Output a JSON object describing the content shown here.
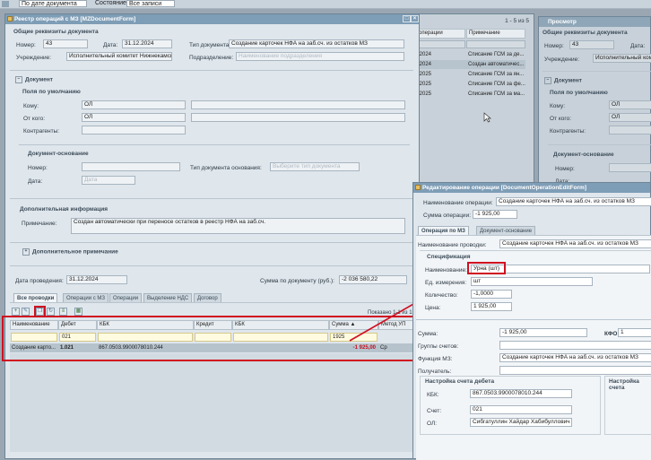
{
  "topbar": {
    "sort_value": "По дате документа",
    "state_label": "Состояние:",
    "state_value": "Все записи"
  },
  "left_window": {
    "title": "Реестр операций с МЗ [MZDocumentForm]",
    "general_section": "Общие реквизиты документа",
    "number_label": "Номер:",
    "number_value": "43",
    "date_label": "Дата:",
    "date_value": "31.12.2024",
    "doctype_label": "Тип документа:",
    "doctype_value": "Создание карточек НФА на заб.сч. из остатков МЗ",
    "institution_label": "Учреждение:",
    "institution_value": "Исполнительный комитет Нижнекамск",
    "division_label": "Подразделение:",
    "division_placeholder": "Наименование подразделения",
    "document_section": "Документ",
    "defaults_section": "Поля по умолчанию",
    "to_label": "Кому:",
    "to_value": "ОЛ",
    "from_label": "От кого:",
    "from_value": "ОЛ",
    "contractors_label": "Контрагенты:",
    "basis_section": "Документ-основание",
    "basis_number_label": "Номер:",
    "basis_type_label": "Тип документа основания:",
    "basis_type_placeholder": "Выберите тип документа",
    "basis_date_label": "Дата:",
    "basis_date_placeholder": "Дата",
    "extra_section": "Дополнительная информация",
    "notes_label": "Примечание:",
    "notes_value": "Создан автоматически при переносе остатков в реестр НФА на заб.сч.",
    "extra_note_section": "Дополнительное примечание",
    "posting_date_label": "Дата проведения:",
    "posting_date_value": "31.12.2024",
    "sum_label": "Сумма по документу (руб.):",
    "sum_value": "-2 036 580,22",
    "tabs": [
      "Все проводки",
      "Операции с МЗ",
      "Операции",
      "Выделение НДС",
      "Договор"
    ],
    "shown_label": "Показано 1-1 из 1",
    "grid_headers": [
      "Наименование",
      "Дебет",
      "КБК",
      "Кредит",
      "КБК",
      "Сумма ▲",
      "Метод УП"
    ],
    "filter_debit": "021",
    "filter_sum": "1925",
    "row": {
      "name": "Создание карто...",
      "debit": "1.021",
      "kbk": "867.0503.9900078010.244",
      "sum": "-1 925,00",
      "method": "Ср"
    }
  },
  "middle_list": {
    "pager": "1 - 5 из 5",
    "col_operations": "операции",
    "col_notes": "Примечание",
    "rows": [
      {
        "date": ".2024",
        "note": "Списание ГСМ за де..."
      },
      {
        "date": ".2024",
        "note": "Создан автоматичес..."
      },
      {
        "date": ".2025",
        "note": "Списание ГСМ за ян..."
      },
      {
        "date": ".2025",
        "note": "Списание ГСМ за фе..."
      },
      {
        "date": ".2025",
        "note": "Списание ГСМ за ма..."
      }
    ]
  },
  "right_window": {
    "title": "Просмотр",
    "general_section": "Общие реквизиты документа",
    "number_label": "Номер:",
    "number_value": "43",
    "date_label": "Дата:",
    "institution_label": "Учреждение:",
    "institution_value": "Исполнительный комит",
    "document_section": "Документ",
    "defaults_section": "Поля по умолчанию",
    "to_label": "Кому:",
    "to_value": "ОЛ",
    "from_label": "От кого:",
    "from_value": "ОЛ",
    "contractors_label": "Контрагенты:",
    "basis_section": "Документ-основание",
    "basis_number_label": "Номер:",
    "basis_date_label": "Дата:"
  },
  "edit_window": {
    "title": "Редактирование операции [DocumentOperationEditForm]",
    "op_name_label": "Наименование операции:",
    "op_name_value": "Создание карточек НФА на заб.сч. из остатков МЗ",
    "op_sum_label": "Сумма операции:",
    "op_sum_value": "-1 925,00",
    "tabs": [
      "Операция по МЗ",
      "Документ-основание"
    ],
    "posting_name_label": "Наименование проводки:",
    "posting_name_value": "Создание карточек НФА на заб.сч. из остатков МЗ",
    "spec_section": "Спецификация",
    "item_name_label": "Наименование:",
    "item_name_value": "Урна (шт)",
    "unit_label": "Ед. измерения:",
    "unit_value": "шт",
    "qty_label": "Количество:",
    "qty_value": "-1,0000",
    "price_label": "Цена:",
    "price_value": "1 925,00",
    "sum_label": "Сумма:",
    "sum_value": "-1 925,00",
    "kfo_label": "КФО:",
    "kfo_value": "1",
    "account_groups_label": "Группы счетов:",
    "function_label": "Функция МЗ:",
    "function_value": "Создание карточек НФА на заб.сч. из остатков МЗ",
    "recipient_label": "Получатель:",
    "debit_section": "Настройка счета дебета",
    "credit_section": "Настройка счета",
    "kbk_label": "КБК:",
    "kbk_value": "867.0503.9900078010.244",
    "account_label": "Счет:",
    "account_value": "021",
    "ol_label": "ОЛ:",
    "ol_value": "Сибгатуллин Хайдар Хабибуллович"
  },
  "colors": {
    "highlight": "#d01020",
    "titlebar": "#7e9db6"
  }
}
